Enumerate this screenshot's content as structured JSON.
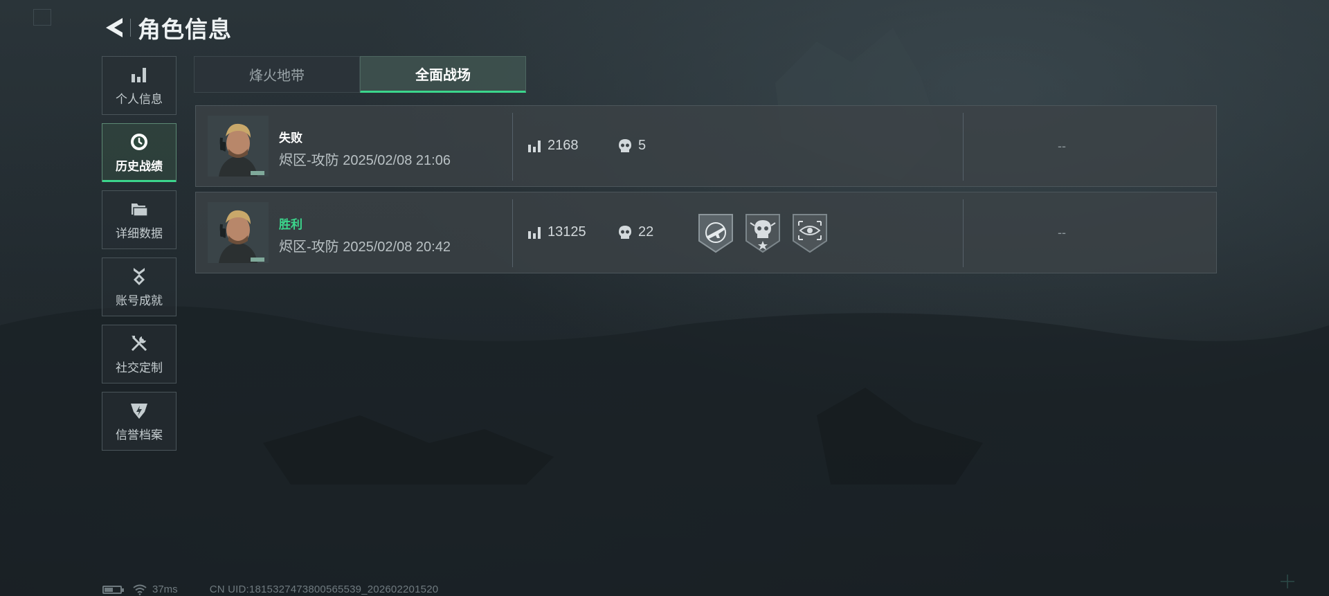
{
  "header": {
    "title": "角色信息",
    "back_icon": "back-arrow-icon"
  },
  "sidebar": {
    "items": [
      {
        "label": "个人信息",
        "icon": "bar-chart-icon",
        "active": false
      },
      {
        "label": "历史战绩",
        "icon": "clock-icon",
        "active": true
      },
      {
        "label": "详细数据",
        "icon": "folder-icon",
        "active": false
      },
      {
        "label": "账号成就",
        "icon": "achievement-icon",
        "active": false
      },
      {
        "label": "社交定制",
        "icon": "tools-icon",
        "active": false
      },
      {
        "label": "信誉档案",
        "icon": "shield-icon",
        "active": false
      }
    ]
  },
  "tabs": [
    {
      "label": "烽火地带",
      "active": false
    },
    {
      "label": "全面战场",
      "active": true
    }
  ],
  "records": [
    {
      "result": "失败",
      "result_type": "loss",
      "map_mode": "烬区-攻防",
      "datetime": "2025/02/08 21:06",
      "score": "2168",
      "kills": "5",
      "medals": [],
      "extra": "--"
    },
    {
      "result": "胜利",
      "result_type": "win",
      "map_mode": "烬区-攻防",
      "datetime": "2025/02/08 20:42",
      "score": "13125",
      "kills": "22",
      "medals": [
        "rifle-medal-icon",
        "skull-medal-icon",
        "eye-medal-icon"
      ],
      "extra": "--"
    }
  ],
  "status": {
    "ping": "37ms",
    "uid": "CN UID:1815327473800565539_202602201520"
  },
  "colors": {
    "accent": "#3bd68c",
    "win": "#3bd68c",
    "loss": "#ffffff"
  }
}
